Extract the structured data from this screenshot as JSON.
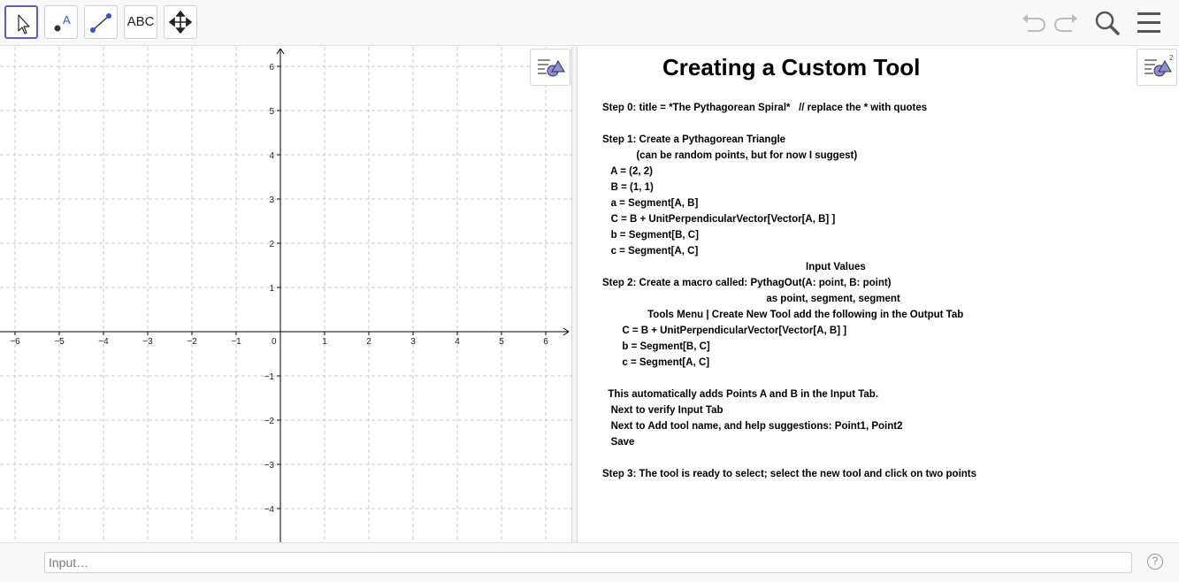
{
  "toolbar": {
    "tools": [
      {
        "name": "move-tool",
        "icon": "arrow-pointer-icon"
      },
      {
        "name": "point-tool",
        "icon": "point-icon",
        "glyph": "A"
      },
      {
        "name": "segment-tool",
        "icon": "segment-icon"
      },
      {
        "name": "text-tool",
        "icon": "text-icon",
        "label": "ABC"
      },
      {
        "name": "move-graphics-view-tool",
        "icon": "move-arrows-icon"
      }
    ],
    "right": [
      "undo-icon",
      "redo-icon",
      "search-icon",
      "menu-icon"
    ],
    "accent": "#6557d2"
  },
  "graphics": {
    "x_ticks": [
      "−6",
      "−5",
      "−4",
      "−3",
      "−2",
      "−1",
      "0",
      "1",
      "2",
      "3",
      "4",
      "5",
      "6"
    ],
    "y_ticks_pos": [
      "6",
      "5",
      "4",
      "3",
      "2",
      "1"
    ],
    "y_ticks_neg": [
      "−1",
      "−2",
      "−3",
      "−4"
    ],
    "grid": true
  },
  "doc": {
    "title": "Creating a Custom Tool",
    "lines": [
      "Step 0: title = *The Pythagorean Spiral*   // replace the * with quotes",
      "",
      "Step 1: Create a Pythagorean Triangle",
      "            (can be random points, but for now I suggest)",
      "   A = (2, 2)",
      "   B = (1, 1)",
      "   a = Segment[A, B]",
      "   C = B + UnitPerpendicularVector[Vector[A, B] ]",
      "   b = Segment[B, C]",
      "   c = Segment[A, C]",
      "                                                                        Input Values",
      "Step 2: Create a macro called: PythagOut(A: point, B: point)",
      "                                                          as point, segment, segment",
      "                Tools Menu | Create New Tool add the following in the Output Tab",
      "       C = B + UnitPerpendicularVector[Vector[A, B] ]",
      "       b = Segment[B, C]",
      "       c = Segment[A, C]",
      "",
      "  This automatically adds Points A and B in the Input Tab.",
      "   Next to verify Input Tab",
      "   Next to Add tool name, and help suggestions: Point1, Point2",
      "   Save",
      "",
      "Step 3: The tool is ready to select; select the new tool and click on two points"
    ]
  },
  "input": {
    "placeholder": "Input…",
    "help": "?"
  }
}
